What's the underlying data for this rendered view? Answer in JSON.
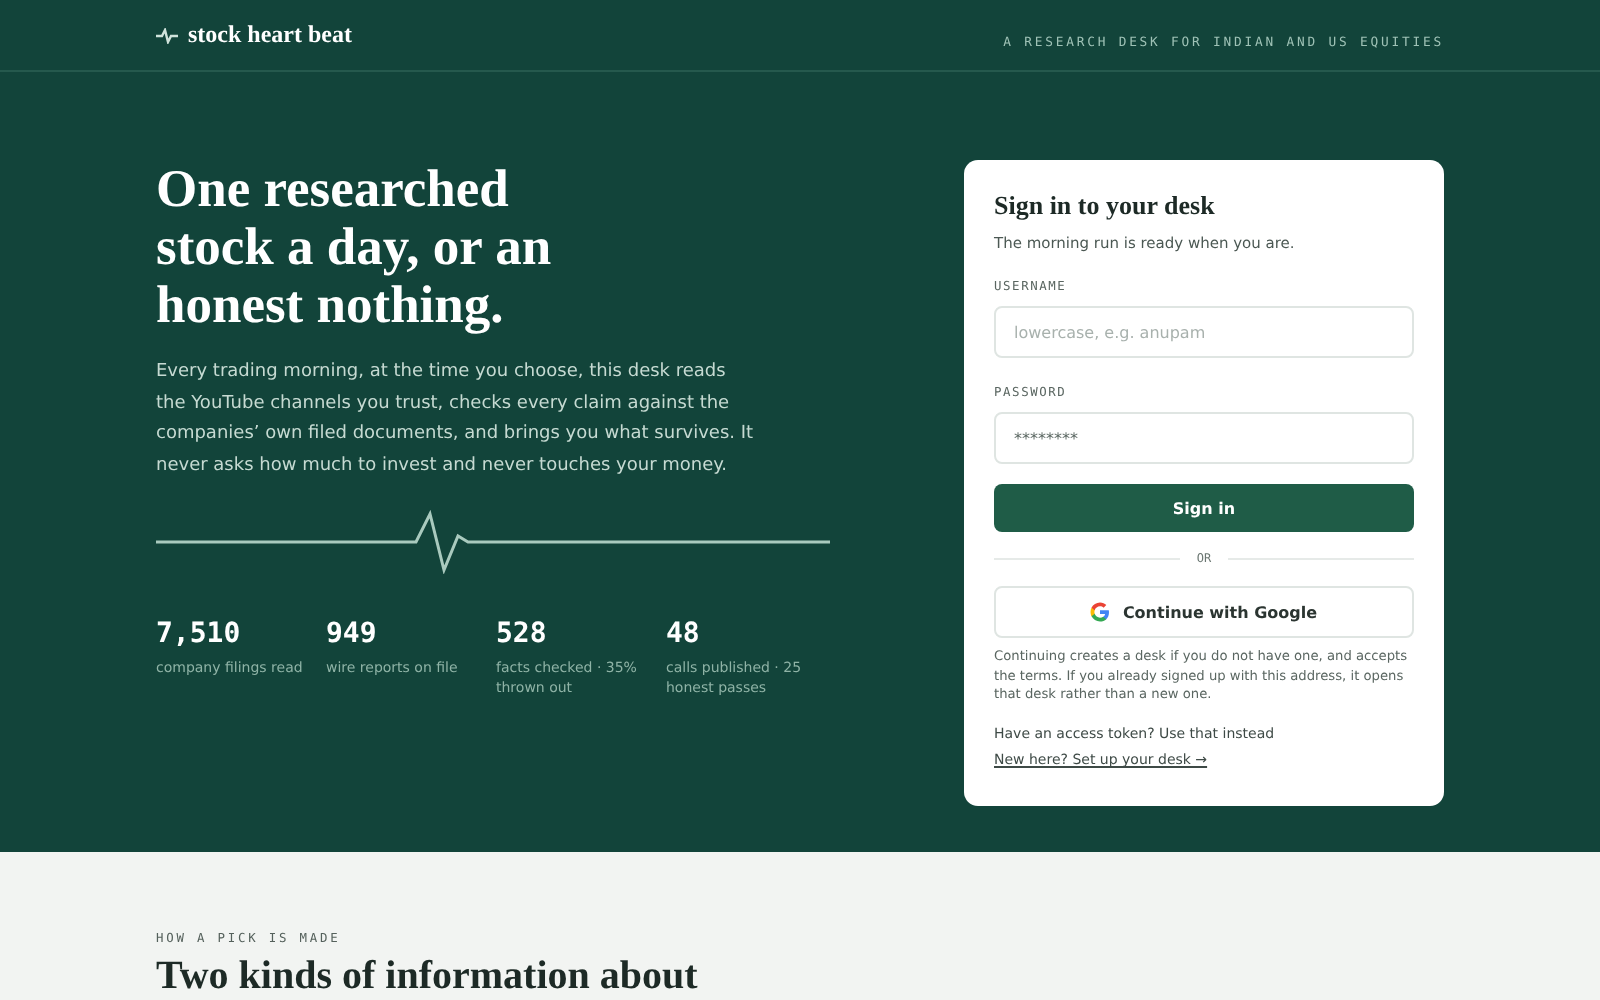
{
  "header": {
    "brand": "stock heart beat",
    "tagline": "A RESEARCH DESK FOR INDIAN AND US EQUITIES"
  },
  "hero": {
    "headline_lines": [
      "One researched",
      "stock a day, or an",
      "honest nothing."
    ],
    "body": "Every trading morning, at the time you choose, this desk reads the YouTube channels you trust, checks every claim against the companies’ own filed documents, and brings you what survives. It never asks how much to invest and never touches your money.",
    "stats": [
      {
        "value": "7,510",
        "label": "company filings read"
      },
      {
        "value": "949",
        "label": "wire reports on file"
      },
      {
        "value": "528",
        "label": "facts checked · 35% thrown out"
      },
      {
        "value": "48",
        "label": "calls published · 25 honest passes"
      }
    ]
  },
  "signin": {
    "title": "Sign in to your desk",
    "subtitle": "The morning run is ready when you are.",
    "fields": [
      {
        "label": "USERNAME",
        "placeholder": "lowercase, e.g. anupam"
      },
      {
        "label": "PASSWORD",
        "value": "********"
      }
    ],
    "submit": "Sign in",
    "divider": "OR",
    "google": "Continue with Google",
    "note": "Continuing creates a desk if you do not have one, and accepts the terms. If you already signed up with this address, it opens that desk rather than a new one.",
    "links": [
      {
        "text": "Have an access token? Use that instead",
        "underlined": false
      },
      {
        "text": "New here? Set up your desk →",
        "underlined": true
      }
    ]
  },
  "section": {
    "eyebrow": "HOW A PICK IS MADE",
    "heading": "Two kinds of information about"
  }
}
